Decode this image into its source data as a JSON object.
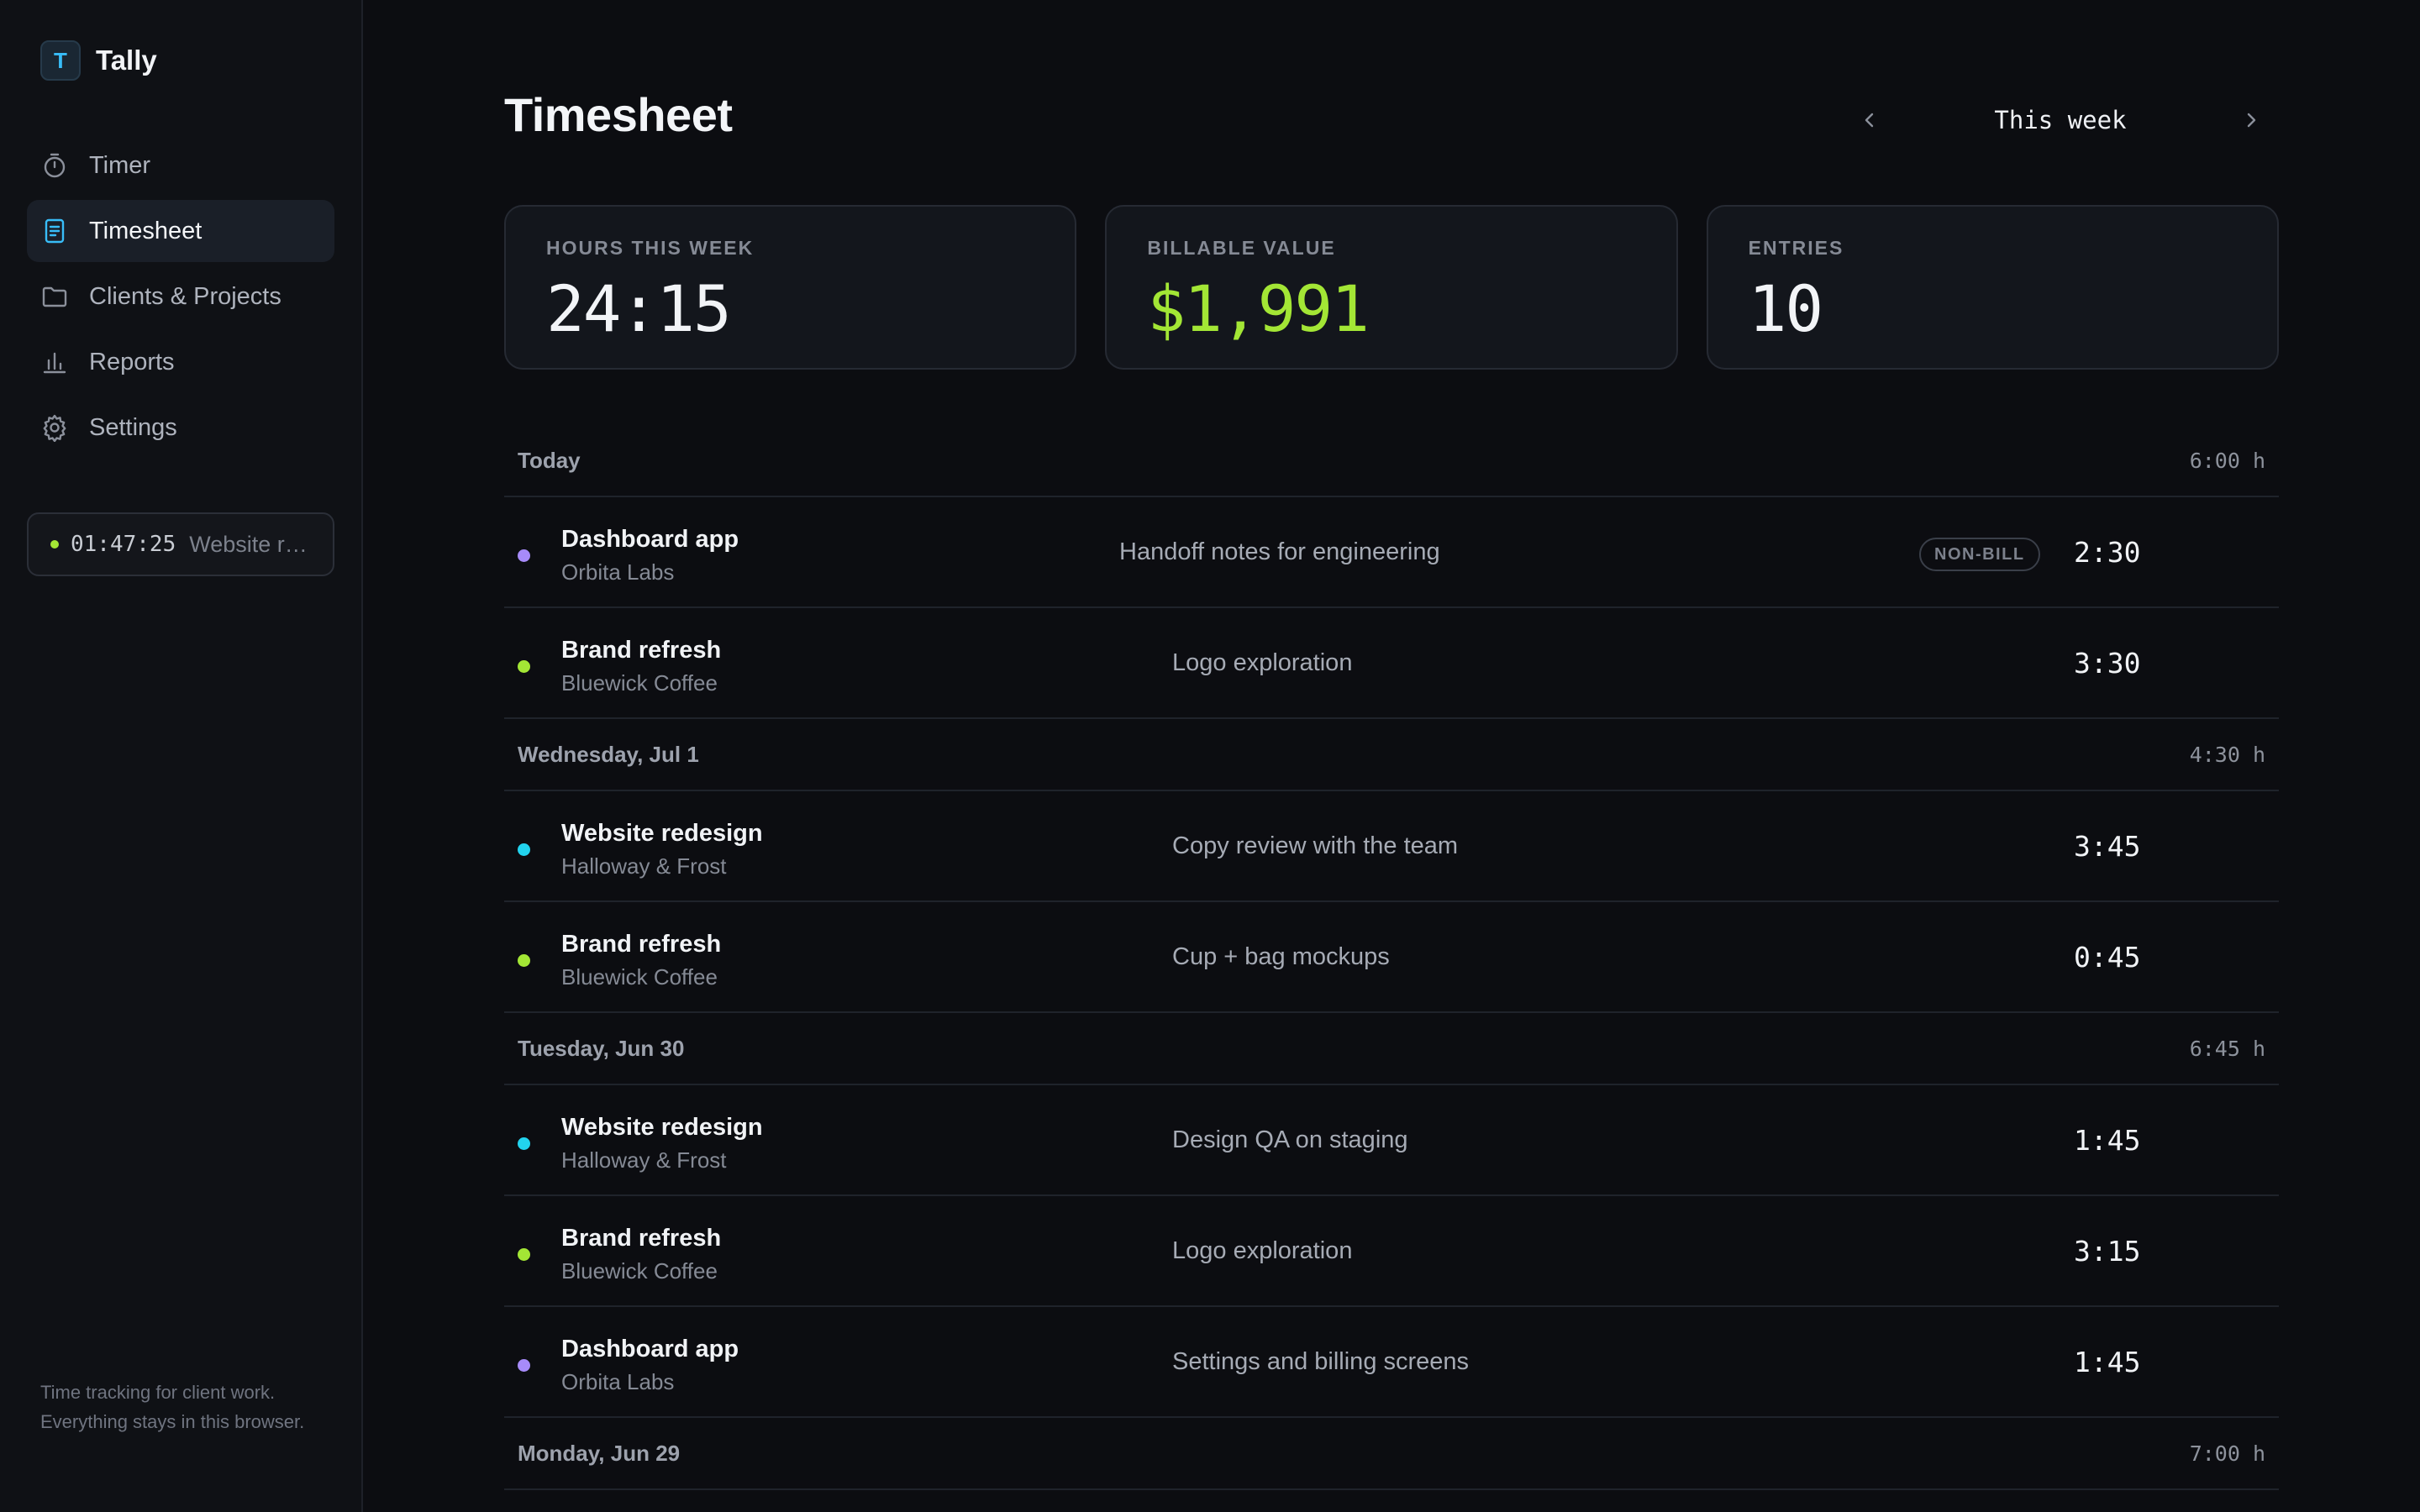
{
  "brand": {
    "letter": "T",
    "name": "Tally",
    "accent": "#38bdf8"
  },
  "nav": [
    {
      "label": "Timer",
      "icon": "stopwatch-icon",
      "active": false
    },
    {
      "label": "Timesheet",
      "icon": "document-icon",
      "active": true
    },
    {
      "label": "Clients & Projects",
      "icon": "folder-icon",
      "active": false
    },
    {
      "label": "Reports",
      "icon": "bar-chart-icon",
      "active": false
    },
    {
      "label": "Settings",
      "icon": "gear-icon",
      "active": false
    }
  ],
  "running_timer": {
    "time": "01:47:25",
    "project": "Website redesign",
    "status_color": "#a3e635"
  },
  "footer_text": "Time tracking for client work. Everything stays in this browser.",
  "header": {
    "title": "Timesheet",
    "range_label": "This week"
  },
  "stats": [
    {
      "label": "HOURS THIS WEEK",
      "value": "24:15"
    },
    {
      "label": "BILLABLE VALUE",
      "value": "$1,991",
      "color": "#a3e635"
    },
    {
      "label": "ENTRIES",
      "value": "10"
    }
  ],
  "days": [
    {
      "label": "Today",
      "total": "6:00 h",
      "entries": [
        {
          "project": "Dashboard app",
          "client": "Orbita Labs",
          "description": "Handoff notes for engineering",
          "badge": "NON-BILL",
          "duration": "2:30",
          "color": "#a78bfa"
        },
        {
          "project": "Brand refresh",
          "client": "Bluewick Coffee",
          "description": "Logo exploration",
          "duration": "3:30",
          "color": "#a3e635"
        }
      ]
    },
    {
      "label": "Wednesday, Jul 1",
      "total": "4:30 h",
      "entries": [
        {
          "project": "Website redesign",
          "client": "Halloway & Frost",
          "description": "Copy review with the team",
          "duration": "3:45",
          "color": "#22d3ee"
        },
        {
          "project": "Brand refresh",
          "client": "Bluewick Coffee",
          "description": "Cup + bag mockups",
          "duration": "0:45",
          "color": "#a3e635"
        }
      ]
    },
    {
      "label": "Tuesday, Jun 30",
      "total": "6:45 h",
      "entries": [
        {
          "project": "Website redesign",
          "client": "Halloway & Frost",
          "description": "Design QA on staging",
          "duration": "1:45",
          "color": "#22d3ee"
        },
        {
          "project": "Brand refresh",
          "client": "Bluewick Coffee",
          "description": "Logo exploration",
          "duration": "3:15",
          "color": "#a3e635"
        },
        {
          "project": "Dashboard app",
          "client": "Orbita Labs",
          "description": "Settings and billing screens",
          "duration": "1:45",
          "color": "#a78bfa"
        }
      ]
    },
    {
      "label": "Monday, Jun 29",
      "total": "7:00 h",
      "entries": []
    }
  ]
}
